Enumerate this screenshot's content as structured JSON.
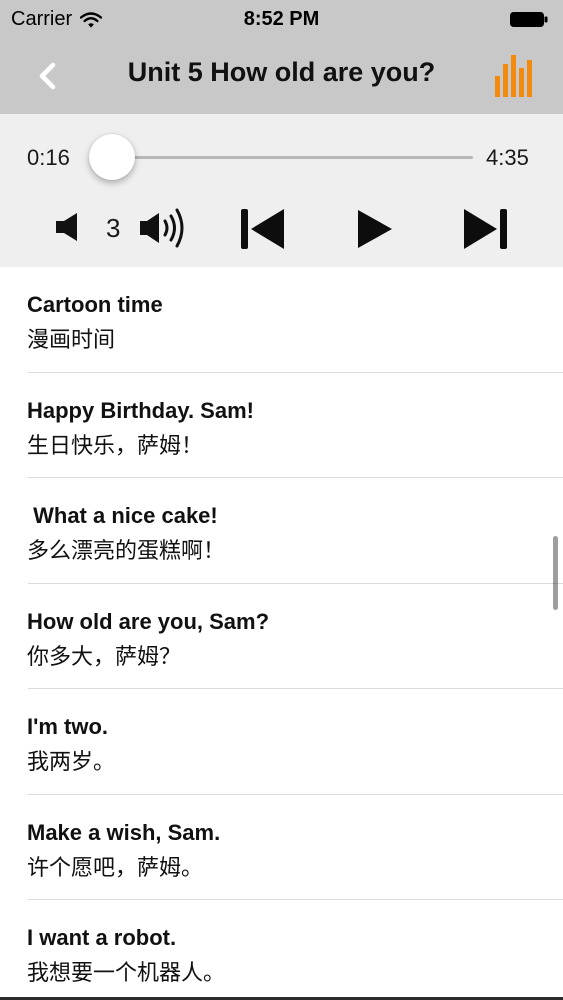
{
  "status_bar": {
    "carrier": "Carrier",
    "time": "8:52 PM"
  },
  "nav": {
    "title": "Unit 5 How old are you?",
    "accent_color": "#f28a0f"
  },
  "player": {
    "elapsed": "0:16",
    "total": "4:35",
    "progress_fraction": 0.058,
    "volume_level": "3",
    "progress_color": "#1e9de0"
  },
  "sentences": [
    {
      "en": "Cartoon time",
      "zh": "漫画时间"
    },
    {
      "en": "Happy Birthday. Sam!",
      "zh": "生日快乐，萨姆！"
    },
    {
      "en": " What a nice cake!",
      "zh": "多么漂亮的蛋糕啊！"
    },
    {
      "en": "How old are you, Sam?",
      "zh": "你多大，萨姆？"
    },
    {
      "en": "I'm two.",
      "zh": "我两岁。"
    },
    {
      "en": "Make a wish, Sam.",
      "zh": "许个愿吧，萨姆。"
    },
    {
      "en": "I want a robot.",
      "zh": "我想要一个机器人。"
    }
  ],
  "icons": {
    "wifi": "wifi-icon",
    "battery": "battery-icon",
    "back": "chevron-left-icon",
    "equalizer": "equalizer-icon",
    "volume_down": "speaker-low-icon",
    "volume_up": "speaker-high-icon",
    "previous": "skip-previous-icon",
    "play": "play-icon",
    "next": "skip-next-icon"
  }
}
